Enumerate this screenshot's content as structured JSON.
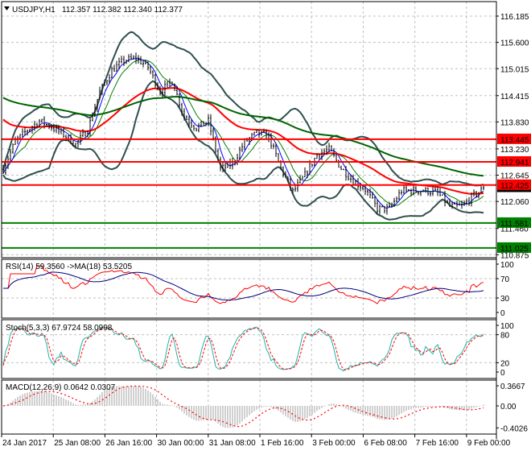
{
  "header": {
    "symbol": "USDJPY,H1",
    "ohlc": "112.357 112.382 112.340 112.377"
  },
  "chart_data": [
    {
      "type": "line",
      "title": "USDJPY,H1",
      "close_path": [
        112.78,
        113.4,
        113.65,
        113.85,
        113.72,
        113.55,
        113.33,
        113.66,
        114.5,
        114.98,
        115.2,
        115.25,
        115.05,
        114.5,
        114.75,
        113.95,
        113.7,
        113.85,
        112.78,
        112.9,
        113.38,
        113.58,
        113.5,
        112.8,
        112.27,
        112.65,
        113.1,
        113.22,
        112.8,
        112.52,
        112.33,
        111.9,
        111.9,
        112.3,
        112.3,
        112.3,
        112.25,
        111.95,
        111.95,
        112.2,
        112.377
      ],
      "y_ticks": [
        "116.185",
        "115.600",
        "115.015",
        "114.415",
        "113.830",
        "113.230",
        "112.645",
        "112.060",
        "111.460",
        "110.875"
      ],
      "ylim": [
        110.875,
        116.185
      ],
      "x_ticks": [
        "24 Jan 2017",
        "25 Jan 08:00",
        "26 Jan 16:00",
        "30 Jan 00:00",
        "31 Jan 08:00",
        "1 Feb 16:00",
        "3 Feb 00:00",
        "6 Feb 08:00",
        "7 Feb 16:00",
        "9 Feb 00:00"
      ],
      "levels": [
        {
          "value": 113.445,
          "label": "113.445",
          "color": "#ff0000"
        },
        {
          "value": 112.941,
          "label": "112.941",
          "color": "#ff0000"
        },
        {
          "value": 112.425,
          "label": "112.425",
          "color": "#ff0000"
        },
        {
          "value": 111.581,
          "label": "111.581",
          "color": "#008000"
        },
        {
          "value": 111.025,
          "label": "111.025",
          "color": "#008000"
        }
      ],
      "current_price": {
        "value": 112.377,
        "label": "112.377",
        "color": "#000000"
      },
      "grid": true
    },
    {
      "type": "line",
      "title": "RSI(14) 59.3560  ->MA(18) 53.5205",
      "y_ticks": [
        "100",
        "70",
        "30",
        "0"
      ],
      "ylim": [
        0,
        100
      ],
      "levels": [
        70,
        30
      ],
      "colors": {
        "rsi": "#ff0000",
        "ma": "#000080"
      }
    },
    {
      "type": "line",
      "title": "Stoch(5,3,3) 67.9724 58.0998",
      "y_ticks": [
        "100",
        "80",
        "20",
        "0"
      ],
      "ylim": [
        0,
        100
      ],
      "levels": [
        80,
        20
      ],
      "colors": {
        "main": "#20b2aa",
        "signal": "#ff0000"
      }
    },
    {
      "type": "bar",
      "title": "MACD(12,26,9) 0.0642 0.0307",
      "y_ticks": [
        "0.3667",
        "0.00",
        "-0.4026"
      ],
      "ylim": [
        -0.4026,
        0.3667
      ],
      "colors": {
        "histogram": "#c0c0c0",
        "signal": "#ff0000"
      }
    }
  ]
}
